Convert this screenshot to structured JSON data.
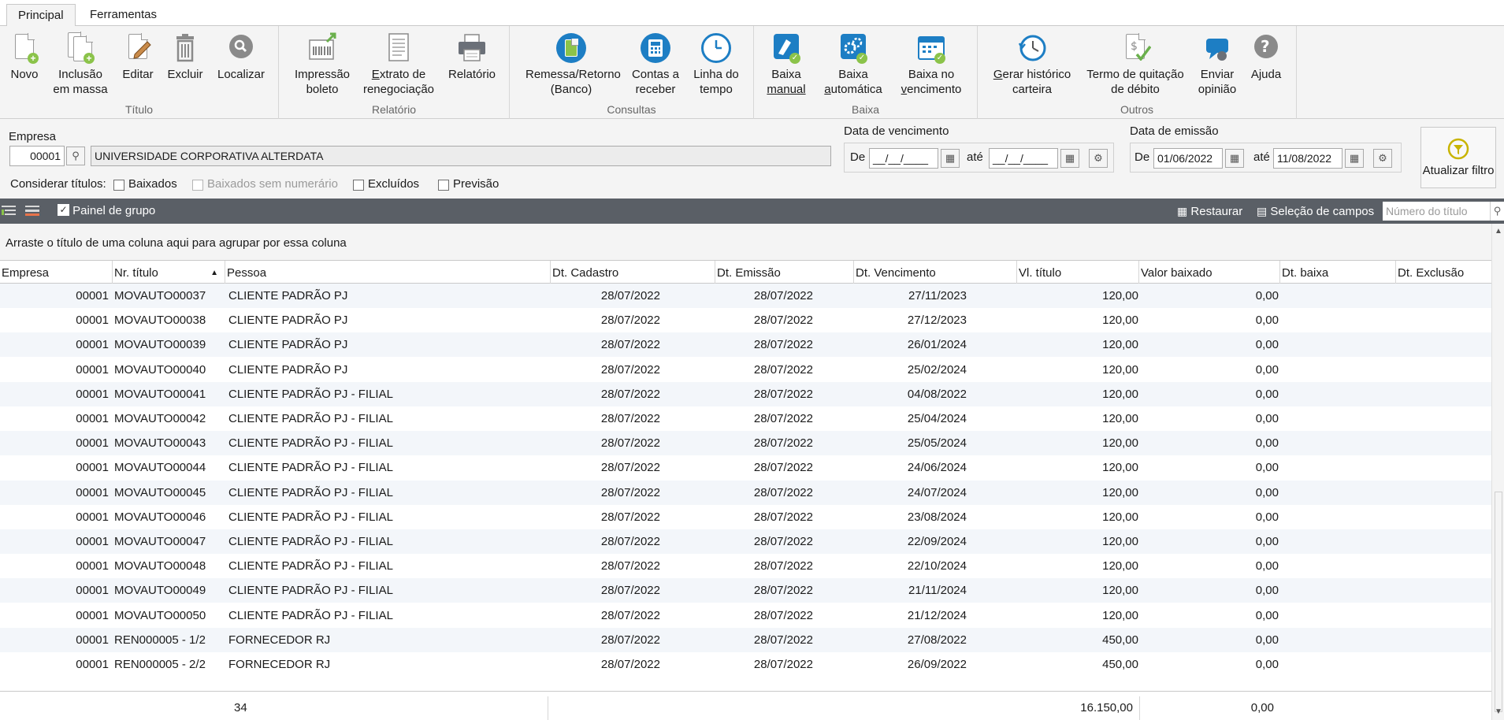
{
  "tabs": [
    {
      "label": "Principal"
    },
    {
      "label": "Ferramentas"
    }
  ],
  "ribbon": {
    "groups": {
      "titulo": "Título",
      "relatorio": "Relatório",
      "consultas": "Consultas",
      "baixa": "Baixa",
      "outros": "Outros"
    },
    "buttons": {
      "novo": "Novo",
      "inclusao_1": "Inclusão",
      "inclusao_2": "em massa",
      "editar": "Editar",
      "excluir": "Excluir",
      "localizar": "Localizar",
      "impressao_1": "Impressão",
      "impressao_2": "boleto",
      "extrato_1": "Extrato de",
      "extrato_2": "renegociação",
      "relatorio": "Relatório",
      "remessa_1": "Remessa/Retorno",
      "remessa_2": "(Banco)",
      "contas_1": "Contas a",
      "contas_2": "receber",
      "linha_1": "Linha do",
      "linha_2": "tempo",
      "baixa_manual_1": "Baixa",
      "baixa_manual_2": "manual",
      "baixa_auto_1": "Baixa",
      "baixa_auto_2": "automática",
      "baixa_venc_1": "Baixa no",
      "baixa_venc_2": "vencimento",
      "gerar_1": "Gerar histórico",
      "gerar_2": "carteira",
      "termo_1": "Termo de quitação",
      "termo_2": "de débito",
      "enviar_1": "Enviar",
      "enviar_2": "opinião",
      "ajuda": "Ajuda"
    }
  },
  "filters": {
    "empresa_label": "Empresa",
    "empresa_code": "00001",
    "empresa_name": "UNIVERSIDADE CORPORATIVA ALTERDATA",
    "vencimento_label": "Data de vencimento",
    "emissao_label": "Data de emissão",
    "de_label": "De",
    "ate_label": "até",
    "venc_de": "__/__/____",
    "venc_ate": "__/__/____",
    "emis_de": "01/06/2022",
    "emis_ate": "11/08/2022",
    "considerar_label": "Considerar títulos:",
    "checks": {
      "baixados": "Baixados",
      "sem_numerario": "Baixados sem numerário",
      "excluidos": "Excluídos",
      "previsao": "Previsão"
    },
    "refresh_label": "Atualizar filtro"
  },
  "toolbar": {
    "painel_grupo": "Painel de grupo",
    "restaurar": "Restaurar",
    "selecao_campos": "Seleção de campos",
    "search_placeholder": "Número do título"
  },
  "group_panel_hint": "Arraste o título de uma coluna aqui para agrupar por essa coluna",
  "grid": {
    "columns": [
      "Empresa",
      "Nr. título",
      "Pessoa",
      "Dt. Cadastro",
      "Dt. Emissão",
      "Dt. Vencimento",
      "Vl. título",
      "Valor baixado",
      "Dt. baixa",
      "Dt. Exclusão"
    ],
    "rows": [
      [
        "00001",
        "MOVAUTO00037",
        "CLIENTE PADRÃO PJ",
        "28/07/2022",
        "28/07/2022",
        "27/11/2023",
        "120,00",
        "0,00"
      ],
      [
        "00001",
        "MOVAUTO00038",
        "CLIENTE PADRÃO PJ",
        "28/07/2022",
        "28/07/2022",
        "27/12/2023",
        "120,00",
        "0,00"
      ],
      [
        "00001",
        "MOVAUTO00039",
        "CLIENTE PADRÃO PJ",
        "28/07/2022",
        "28/07/2022",
        "26/01/2024",
        "120,00",
        "0,00"
      ],
      [
        "00001",
        "MOVAUTO00040",
        "CLIENTE PADRÃO PJ",
        "28/07/2022",
        "28/07/2022",
        "25/02/2024",
        "120,00",
        "0,00"
      ],
      [
        "00001",
        "MOVAUTO00041",
        "CLIENTE PADRÃO PJ - FILIAL",
        "28/07/2022",
        "28/07/2022",
        "04/08/2022",
        "120,00",
        "0,00"
      ],
      [
        "00001",
        "MOVAUTO00042",
        "CLIENTE PADRÃO PJ - FILIAL",
        "28/07/2022",
        "28/07/2022",
        "25/04/2024",
        "120,00",
        "0,00"
      ],
      [
        "00001",
        "MOVAUTO00043",
        "CLIENTE PADRÃO PJ - FILIAL",
        "28/07/2022",
        "28/07/2022",
        "25/05/2024",
        "120,00",
        "0,00"
      ],
      [
        "00001",
        "MOVAUTO00044",
        "CLIENTE PADRÃO PJ - FILIAL",
        "28/07/2022",
        "28/07/2022",
        "24/06/2024",
        "120,00",
        "0,00"
      ],
      [
        "00001",
        "MOVAUTO00045",
        "CLIENTE PADRÃO PJ - FILIAL",
        "28/07/2022",
        "28/07/2022",
        "24/07/2024",
        "120,00",
        "0,00"
      ],
      [
        "00001",
        "MOVAUTO00046",
        "CLIENTE PADRÃO PJ - FILIAL",
        "28/07/2022",
        "28/07/2022",
        "23/08/2024",
        "120,00",
        "0,00"
      ],
      [
        "00001",
        "MOVAUTO00047",
        "CLIENTE PADRÃO PJ - FILIAL",
        "28/07/2022",
        "28/07/2022",
        "22/09/2024",
        "120,00",
        "0,00"
      ],
      [
        "00001",
        "MOVAUTO00048",
        "CLIENTE PADRÃO PJ - FILIAL",
        "28/07/2022",
        "28/07/2022",
        "22/10/2024",
        "120,00",
        "0,00"
      ],
      [
        "00001",
        "MOVAUTO00049",
        "CLIENTE PADRÃO PJ - FILIAL",
        "28/07/2022",
        "28/07/2022",
        "21/11/2024",
        "120,00",
        "0,00"
      ],
      [
        "00001",
        "MOVAUTO00050",
        "CLIENTE PADRÃO PJ - FILIAL",
        "28/07/2022",
        "28/07/2022",
        "21/12/2024",
        "120,00",
        "0,00"
      ],
      [
        "00001",
        "REN000005 - 1/2",
        "FORNECEDOR RJ",
        "28/07/2022",
        "28/07/2022",
        "27/08/2022",
        "450,00",
        "0,00"
      ],
      [
        "00001",
        "REN000005 - 2/2",
        "FORNECEDOR RJ",
        "28/07/2022",
        "28/07/2022",
        "26/09/2022",
        "450,00",
        "0,00"
      ]
    ],
    "footer": {
      "count": "34",
      "total_titulo": "16.150,00",
      "total_baixado": "0,00"
    }
  },
  "colors": {
    "accent": "#1d7ec4",
    "toolbar": "#5a5f66",
    "green": "#8bc34a",
    "row_alt": "#f3f6fa"
  }
}
